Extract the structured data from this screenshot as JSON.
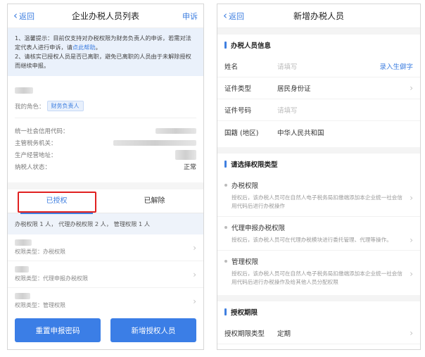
{
  "left": {
    "nav": {
      "back": "返回",
      "title": "企业办税人员列表",
      "right": "申诉"
    },
    "notice": {
      "line1": "1、温馨提示：目前仅支持对办税权限为财务负责人的申诉，若需对法定代表人进行申诉，请",
      "link": "点此帮助",
      "line1_end": "。",
      "line2": "2、请核实已授权人员是否已离职，避免已离职的人员由于未解除授权而继续申报。"
    },
    "profile": {
      "role_label": "我的角色：",
      "role_tag": "财务负责人"
    },
    "info": [
      {
        "label": "统一社会信用代码：",
        "value": ""
      },
      {
        "label": "主管税务机关：",
        "value": ""
      },
      {
        "label": "生产经营地址：",
        "value": ""
      },
      {
        "label": "纳税人状态：",
        "value": "正常"
      }
    ],
    "tabs": [
      {
        "label": "已授权"
      },
      {
        "label": "已解除"
      }
    ],
    "summary": "办税权限 1 人， 代理办税权限 2 人， 管理权限 1 人",
    "items": [
      {
        "sub": "权限类型：办税权限"
      },
      {
        "sub": "权限类型：代理申报办税权限"
      },
      {
        "sub": "权限类型：管理权限"
      }
    ],
    "buttons": {
      "reset": "重置申报密码",
      "add": "新增授权人员"
    }
  },
  "right": {
    "nav": {
      "back": "返回",
      "title": "新增办税人员"
    },
    "section1": "办税人员信息",
    "fields": {
      "name": {
        "label": "姓名",
        "placeholder": "请填写",
        "action": "录入生僻字"
      },
      "id_type": {
        "label": "证件类型",
        "value": "居民身份证"
      },
      "id_no": {
        "label": "证件号码",
        "placeholder": "请填写"
      },
      "nationality": {
        "label": "国籍 (地区)",
        "value": "中华人民共和国"
      }
    },
    "section2": "请选择权限类型",
    "perms": [
      {
        "title": "办税权限",
        "desc": "授权后，该办税人员可在自然人电子税务局扣缴端添加本企业统一社会信用代码后进行办税操作"
      },
      {
        "title": "代理申报办税权限",
        "desc": "授权后，该办税人员可在代理办税模块进行委托管理、代理等操作。"
      },
      {
        "title": "管理权限",
        "desc": "授权后，该办税人员可在自然人电子税务局扣缴端添加本企业统一社会信用代码后进行办税操作及给其他人员分配权限"
      }
    ],
    "section3": "授权期限",
    "period": {
      "label": "授权期限类型",
      "value": "定期"
    }
  }
}
